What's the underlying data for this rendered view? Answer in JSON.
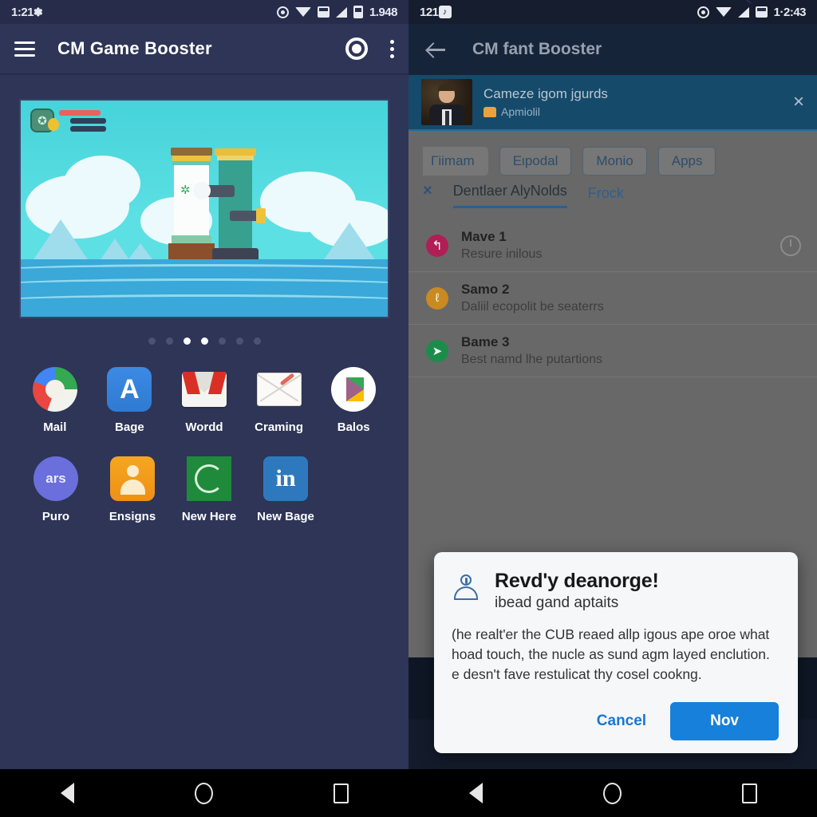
{
  "left": {
    "status": {
      "time_left": "1:21",
      "bt_icon": "bluetooth-icon",
      "clock": "1.948"
    },
    "toolbar": {
      "menu_icon": "hamburger-menu-icon",
      "title": "CM Game Booster",
      "boost_icon": "boost-target-icon",
      "overflow_icon": "overflow-menu-icon"
    },
    "banner": {
      "name": "game-promo-banner",
      "hud_badge_glyph": "✪"
    },
    "pager": {
      "count": 7,
      "active": [
        2,
        3
      ]
    },
    "apps_row1": [
      {
        "label": "Mail",
        "icon": "google-circle-icon"
      },
      {
        "label": "Bage",
        "icon": "blue-a-app-icon",
        "glyph": "A"
      },
      {
        "label": "Wordd",
        "icon": "gmail-envelope-icon"
      },
      {
        "label": "Craming",
        "icon": "mail-pen-icon"
      },
      {
        "label": "Balos",
        "icon": "play-store-icon"
      }
    ],
    "apps_row2": [
      {
        "label": "Puro",
        "icon": "ars-circle-icon",
        "glyph": "ars"
      },
      {
        "label": "Ensigns",
        "icon": "contacts-person-icon"
      },
      {
        "label": "New Here",
        "icon": "green-app-icon"
      },
      {
        "label": "New Bage",
        "icon": "linkedin-icon",
        "glyph": "in"
      }
    ],
    "navbar": {
      "back": "back-triangle-icon",
      "home": "home-circle-icon",
      "recents": "recents-square-icon"
    }
  },
  "right": {
    "status": {
      "time_left": "121",
      "note_icon": "note-badge-icon",
      "clock": "1·2:43"
    },
    "toolbar": {
      "back_icon": "back-arrow-icon",
      "title": "CM fant Booster"
    },
    "promo": {
      "title": "Cameze igom jgurds",
      "subtitle": "Apmiolil",
      "close": "×",
      "photo": "person-photo"
    },
    "chips": [
      "Γiimam",
      "Eιpodal",
      "Monio",
      "Apps"
    ],
    "tabs": {
      "x_icon": "×",
      "items": [
        {
          "label": "Dentlaer AlyNolds",
          "active": true
        },
        {
          "label": "Frock",
          "active": false
        }
      ]
    },
    "list": [
      {
        "title": "Mave 1",
        "subtitle": "Resure inilous",
        "icon": "pink-swirl-icon",
        "glyph": "↰",
        "trailing": "history-clock-icon"
      },
      {
        "title": "Samo 2",
        "subtitle": "Daliil ecopolit be seaterrs",
        "icon": "amber-coin-icon",
        "glyph": "ℓ",
        "trailing": ""
      },
      {
        "title": "Bame 3",
        "subtitle": "Best namd lhe putartions",
        "icon": "green-check-icon",
        "glyph": "➤",
        "trailing": ""
      }
    ],
    "dialog": {
      "icon": "account-person-icon",
      "title": "Revd'y deanorge!",
      "subtitle": "ibead gand aptaits",
      "body": "(he realt'er the CUB reaed allp igous ape oroe what hoad touch, the nucle as sund agm layed enclution. e desn't fave restulicat thy cosel cookng.",
      "cancel_label": "Cancel",
      "confirm_label": "Nov",
      "accent_color": "#1680da"
    },
    "navbar": {
      "back": "back-triangle-icon",
      "home": "home-circle-icon",
      "recents": "recents-square-icon"
    }
  }
}
